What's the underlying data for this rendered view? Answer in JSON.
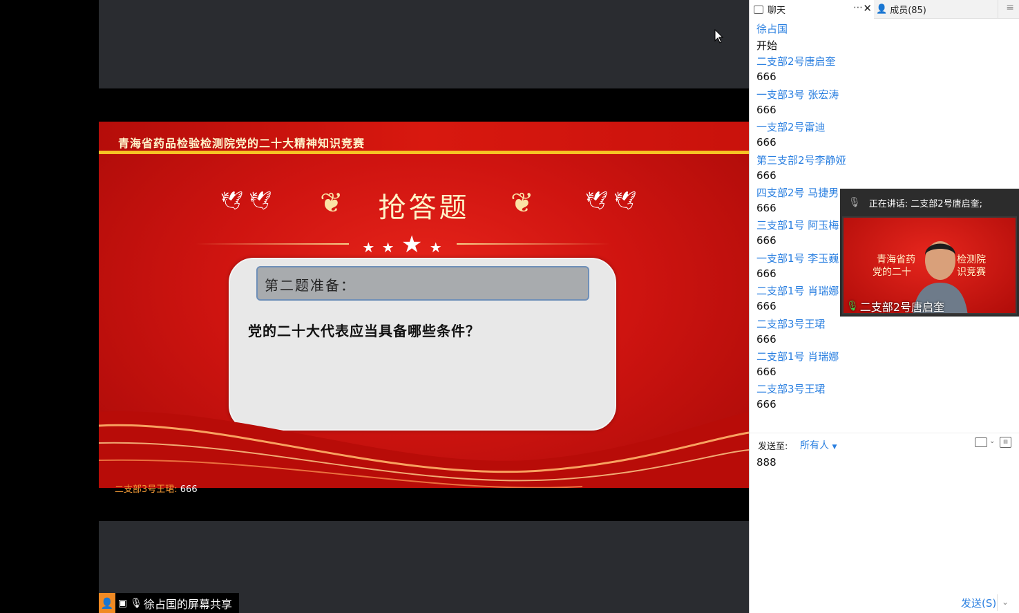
{
  "slide": {
    "header_title": "青海省药品检验检测院党的二十大精神知识竞赛",
    "main_title": "抢答题",
    "question_label": "第二题准备：",
    "question_text": "党的二十大代表应当具备哪些条件？"
  },
  "danmaku": {
    "sender": "二支部3号王珺:",
    "message": " 666"
  },
  "share_status": {
    "label": "徐占国的屏幕共享"
  },
  "panel": {
    "tab_chat_label": "聊天",
    "tab_members_label": "成员(85)",
    "messages": [
      {
        "name": "徐占国",
        "text": "开始"
      },
      {
        "name": "二支部2号唐启奎",
        "text": "666"
      },
      {
        "name": "一支部3号 张宏涛",
        "text": "666"
      },
      {
        "name": "一支部2号雷迪",
        "text": "666"
      },
      {
        "name": "第三支部2号李静娅",
        "text": "666"
      },
      {
        "name": "四支部2号 马捷男",
        "text": "666"
      },
      {
        "name": " 三支部1号  阿玉梅",
        "text": "666"
      },
      {
        "name": "一支部1号 李玉巍",
        "text": "666"
      },
      {
        "name": "二支部1号 肖瑞娜",
        "text": "666"
      },
      {
        "name": "二支部3号王珺",
        "text": "666"
      },
      {
        "name": "二支部1号 肖瑞娜",
        "text": "666"
      },
      {
        "name": "二支部3号王珺",
        "text": "666"
      }
    ],
    "send_to_label": "发送至:",
    "send_to_value": "所有人",
    "input_value": "888",
    "send_button": "发送(S)"
  },
  "video": {
    "speaking_label": "正在讲话: 二支部2号唐启奎;",
    "caption": "二支部2号唐启奎",
    "frame_text_1": "青海省药",
    "frame_text_2": "党的二十",
    "frame_text_3": "检测院",
    "frame_text_4": "识竞赛"
  },
  "colors": {
    "link_blue": "#2a7fe0",
    "slide_red": "#cf1410",
    "gold": "#f6c324",
    "danmaku_orange": "#f39a36",
    "mic_green": "#3ed04b"
  }
}
